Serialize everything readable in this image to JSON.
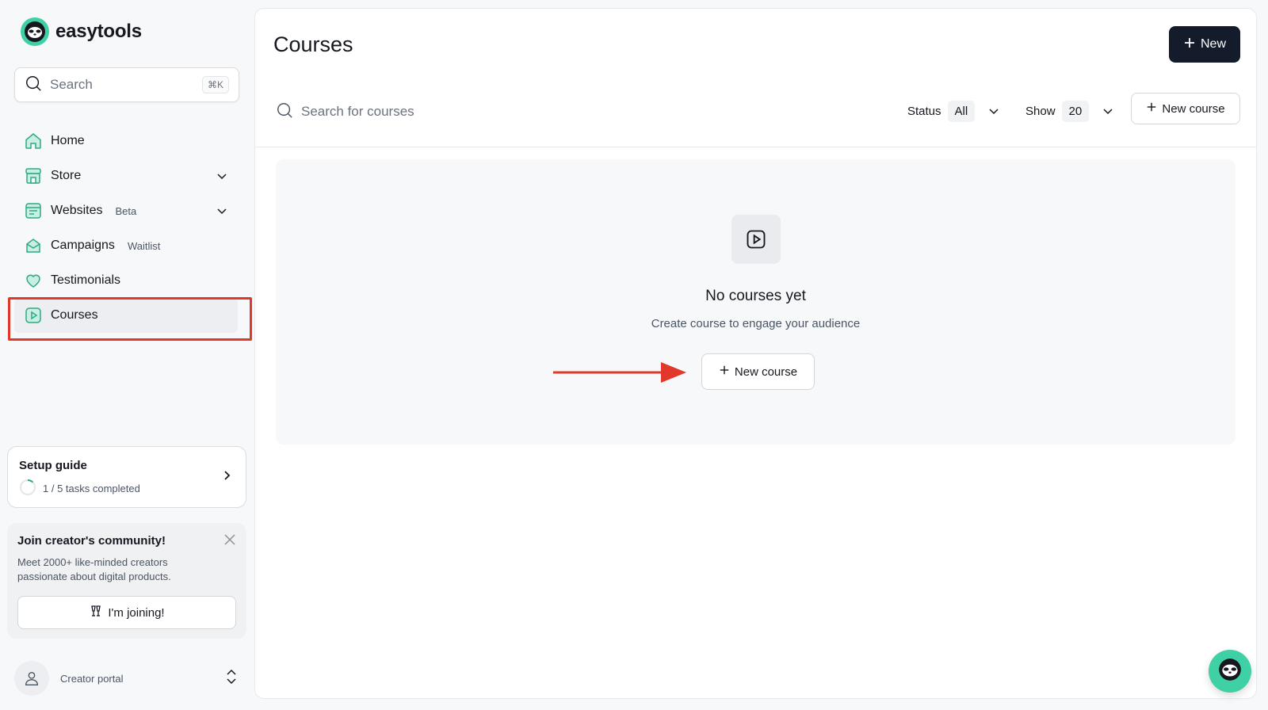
{
  "brand": {
    "name": "easytools"
  },
  "sidebar": {
    "search": {
      "placeholder": "Search",
      "shortcut": "⌘K"
    },
    "items": [
      {
        "label": "Home",
        "icon": "home-icon",
        "tag": ""
      },
      {
        "label": "Store",
        "icon": "store-icon",
        "tag": "",
        "expandable": true
      },
      {
        "label": "Websites",
        "icon": "websites-icon",
        "tag": "Beta",
        "expandable": true
      },
      {
        "label": "Campaigns",
        "icon": "campaigns-icon",
        "tag": "Waitlist"
      },
      {
        "label": "Testimonials",
        "icon": "heart-icon",
        "tag": ""
      },
      {
        "label": "Courses",
        "icon": "courses-icon",
        "tag": "",
        "active": true
      }
    ],
    "setup_guide": {
      "title": "Setup guide",
      "progress_text": "1 / 5 tasks completed",
      "completed": 1,
      "total": 5
    },
    "community": {
      "title": "Join creator's community!",
      "text": "Meet 2000+ like-minded creators passionate about digital products.",
      "button": "I'm joining!"
    },
    "portal": {
      "label": "Creator portal"
    }
  },
  "main": {
    "title": "Courses",
    "new_button": "New",
    "search": {
      "placeholder": "Search for courses"
    },
    "filters": {
      "status_label": "Status",
      "status_value": "All",
      "show_label": "Show",
      "show_value": "20"
    },
    "new_course_button": "New course",
    "empty_state": {
      "title": "No courses yet",
      "subtitle": "Create course to engage your audience",
      "button": "New course"
    }
  },
  "colors": {
    "accent": "#3fd0a6",
    "primary_button": "#141b2b",
    "annotation": "#e2382b"
  }
}
